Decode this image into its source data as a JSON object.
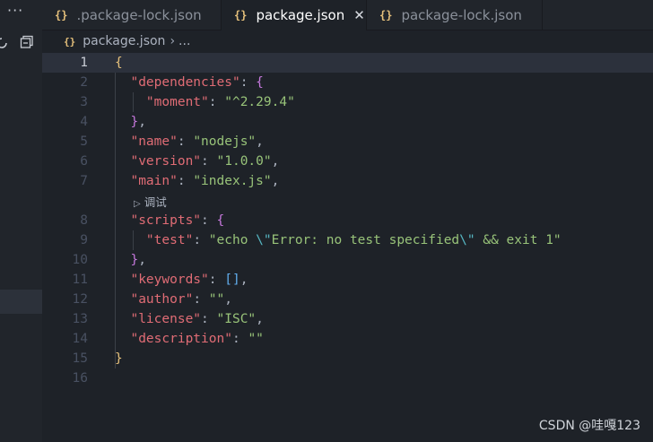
{
  "sidebar": {
    "dots": "···"
  },
  "tabs": [
    {
      "label": ".package-lock.json",
      "icon": "{}"
    },
    {
      "label": "package.json",
      "icon": "{}",
      "active": true,
      "close": "✕"
    },
    {
      "label": "package-lock.json",
      "icon": "{}"
    }
  ],
  "breadcrumb": {
    "icon": "{}",
    "file": "package.json",
    "chev": "›",
    "more": "..."
  },
  "lines": [
    {
      "n": "1",
      "parts": [
        [
          "br1",
          "{"
        ]
      ]
    },
    {
      "n": "2",
      "parts": [
        [
          "p",
          "  "
        ],
        [
          "k",
          "\"dependencies\""
        ],
        [
          "p",
          ": "
        ],
        [
          "br2",
          "{"
        ]
      ]
    },
    {
      "n": "3",
      "parts": [
        [
          "p",
          "    "
        ],
        [
          "k",
          "\"moment\""
        ],
        [
          "p",
          ": "
        ],
        [
          "s",
          "\"^2.29.4\""
        ]
      ]
    },
    {
      "n": "4",
      "parts": [
        [
          "p",
          "  "
        ],
        [
          "br2",
          "}"
        ],
        [
          "p",
          ","
        ]
      ]
    },
    {
      "n": "5",
      "parts": [
        [
          "p",
          "  "
        ],
        [
          "k",
          "\"name\""
        ],
        [
          "p",
          ": "
        ],
        [
          "s",
          "\"nodejs\""
        ],
        [
          "p",
          ","
        ]
      ]
    },
    {
      "n": "6",
      "parts": [
        [
          "p",
          "  "
        ],
        [
          "k",
          "\"version\""
        ],
        [
          "p",
          ": "
        ],
        [
          "s",
          "\"1.0.0\""
        ],
        [
          "p",
          ","
        ]
      ]
    },
    {
      "n": "7",
      "parts": [
        [
          "p",
          "  "
        ],
        [
          "k",
          "\"main\""
        ],
        [
          "p",
          ": "
        ],
        [
          "s",
          "\"index.js\""
        ],
        [
          "p",
          ","
        ]
      ]
    },
    {
      "n": "8",
      "parts": [
        [
          "p",
          "  "
        ],
        [
          "k",
          "\"scripts\""
        ],
        [
          "p",
          ": "
        ],
        [
          "br2",
          "{"
        ]
      ]
    },
    {
      "n": "9",
      "parts": [
        [
          "p",
          "    "
        ],
        [
          "k",
          "\"test\""
        ],
        [
          "p",
          ": "
        ],
        [
          "s",
          "\"echo "
        ],
        [
          "esc",
          "\\\""
        ],
        [
          "s",
          "Error: no test specified"
        ],
        [
          "esc",
          "\\\""
        ],
        [
          "s",
          " && exit 1\""
        ]
      ]
    },
    {
      "n": "10",
      "parts": [
        [
          "p",
          "  "
        ],
        [
          "br2",
          "}"
        ],
        [
          "p",
          ","
        ]
      ]
    },
    {
      "n": "11",
      "parts": [
        [
          "p",
          "  "
        ],
        [
          "k",
          "\"keywords\""
        ],
        [
          "p",
          ": "
        ],
        [
          "br3",
          "[]"
        ],
        [
          "p",
          ","
        ]
      ]
    },
    {
      "n": "12",
      "parts": [
        [
          "p",
          "  "
        ],
        [
          "k",
          "\"author\""
        ],
        [
          "p",
          ": "
        ],
        [
          "s",
          "\"\""
        ],
        [
          "p",
          ","
        ]
      ]
    },
    {
      "n": "13",
      "parts": [
        [
          "p",
          "  "
        ],
        [
          "k",
          "\"license\""
        ],
        [
          "p",
          ": "
        ],
        [
          "s",
          "\"ISC\""
        ],
        [
          "p",
          ","
        ]
      ]
    },
    {
      "n": "14",
      "parts": [
        [
          "p",
          "  "
        ],
        [
          "k",
          "\"description\""
        ],
        [
          "p",
          ": "
        ],
        [
          "s",
          "\"\""
        ]
      ]
    },
    {
      "n": "15",
      "parts": [
        [
          "br1",
          "}"
        ]
      ]
    },
    {
      "n": "16",
      "parts": []
    }
  ],
  "codelens": {
    "triangle": "▷",
    "label": "调试"
  },
  "watermark": "CSDN @哇嘎123",
  "colors": {
    "key": "#e06c75",
    "string": "#98c379",
    "escape": "#56b6c2",
    "brace": "#e5c07b",
    "inner_brace": "#c678dd",
    "bracket": "#61afef"
  }
}
